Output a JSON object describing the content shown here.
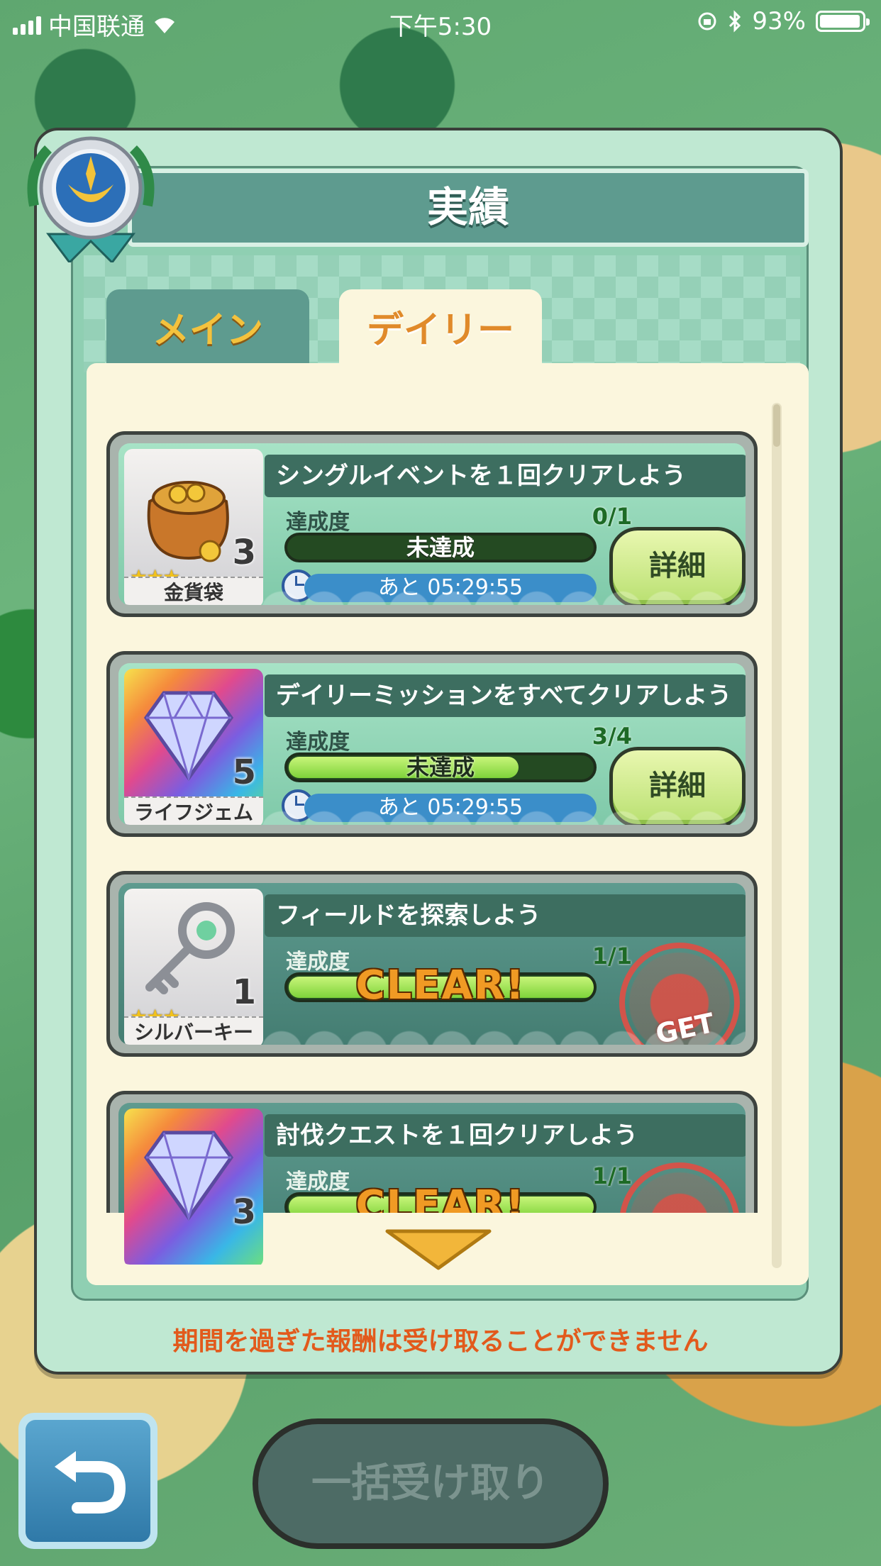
{
  "status_bar": {
    "carrier": "中国联通",
    "time": "下午5:30",
    "battery": "93%"
  },
  "panel": {
    "title": "実績",
    "tabs": [
      {
        "label": "メイン",
        "active": false
      },
      {
        "label": "デイリー",
        "active": true
      }
    ]
  },
  "missions": [
    {
      "title": "シングルイベントを１回クリアしよう",
      "progress_label": "達成度",
      "progress_count": "0/1",
      "progress_fraction": 0.0,
      "status": "未達成",
      "timer": "あと 05:29:55",
      "button": "詳細",
      "reward": {
        "name": "金貨袋",
        "count": "3",
        "stars": "★★★",
        "icon": "gold-bag-icon"
      }
    },
    {
      "title": "デイリーミッションをすべてクリアしよう",
      "progress_label": "達成度",
      "progress_count": "3/4",
      "progress_fraction": 0.75,
      "status": "未達成",
      "timer": "あと 05:29:55",
      "button": "詳細",
      "reward": {
        "name": "ライフジェム",
        "count": "5",
        "icon": "life-gem-icon"
      }
    },
    {
      "title": "フィールドを探索しよう",
      "progress_label": "達成度",
      "progress_count": "1/1",
      "progress_fraction": 1.0,
      "status": "CLEAR!",
      "stamp": "GET",
      "reward": {
        "name": "シルバーキー",
        "count": "1",
        "stars": "★★★",
        "icon": "silver-key-icon"
      }
    },
    {
      "title": "討伐クエストを１回クリアしよう",
      "progress_label": "達成度",
      "progress_count": "1/1",
      "progress_fraction": 1.0,
      "status": "CLEAR!",
      "reward": {
        "count": "3",
        "icon": "life-gem-icon"
      }
    }
  ],
  "footer_note": "期間を過ぎた報酬は受け取ることができません",
  "bulk_button": "一括受け取り",
  "colors": {
    "accent_green": "#7ed33a",
    "timer_blue": "#3b8ec9",
    "note_orange": "#e25a1c"
  }
}
